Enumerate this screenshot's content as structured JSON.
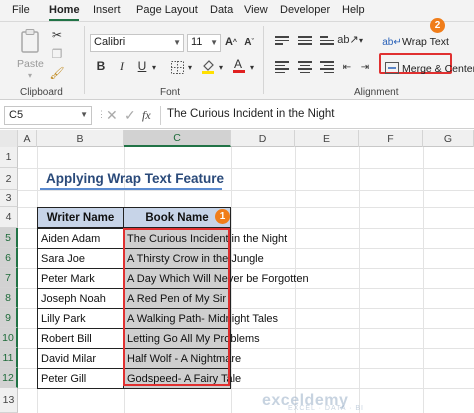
{
  "menu": {
    "tabs": [
      "File",
      "Home",
      "Insert",
      "Page Layout",
      "Data",
      "View",
      "Developer",
      "Help"
    ],
    "active": "Home"
  },
  "ribbon": {
    "clipboard": {
      "paste_label": "Paste",
      "group_label": "Clipboard"
    },
    "font": {
      "font_name": "Calibri",
      "font_size": "11",
      "group_label": "Font"
    },
    "alignment": {
      "wrap_text_label": "Wrap Text",
      "merge_center_label": "Merge & Center",
      "group_label": "Alignment"
    },
    "badge_wrap": "2"
  },
  "formula_bar": {
    "name_box": "C5",
    "fx_label": "fx",
    "value": "The Curious Incident in the Night"
  },
  "columns": [
    "A",
    "B",
    "C",
    "D",
    "E",
    "F",
    "G"
  ],
  "selected_column": "C",
  "rows": [
    "1",
    "2",
    "3",
    "4",
    "5",
    "6",
    "7",
    "8",
    "9",
    "10",
    "11",
    "12",
    "13"
  ],
  "sheet": {
    "title": "Applying Wrap Text Feature",
    "header_writer": "Writer Name",
    "header_book": "Book Name",
    "badge_book": "1",
    "rows": [
      {
        "writer": "Aiden Adam",
        "book": "The Curious Incident in the Night"
      },
      {
        "writer": "Sara Joe",
        "book": "A Thirsty Crow in the Jungle"
      },
      {
        "writer": "Peter Mark",
        "book": "A Day Which Will Never be Forgotten"
      },
      {
        "writer": "Joseph Noah",
        "book": "A Red Pen of My Sir"
      },
      {
        "writer": "Lilly Park",
        "book": "A Walking Path- Midnight Tales"
      },
      {
        "writer": "Robert Bill",
        "book": "Letting Go All My Problems"
      },
      {
        "writer": "David Milar",
        "book": "Half Wolf - A Nightmare"
      },
      {
        "writer": "Peter Gill",
        "book": "Godspeed- A Fairy Tale"
      }
    ]
  },
  "watermark": {
    "name": "exceldemy",
    "tagline": "EXCEL · DATA · BI"
  },
  "colors": {
    "accent": "#217346",
    "highlight": "#e03030",
    "badge": "#f07d1a",
    "header_fill": "#c7d4e8"
  }
}
